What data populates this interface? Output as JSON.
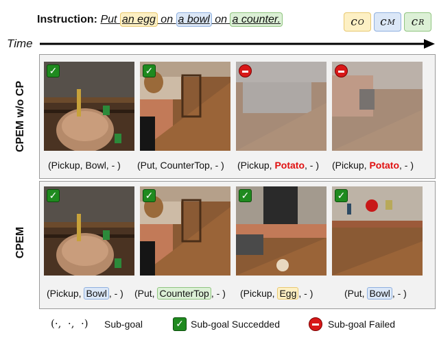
{
  "instruction": {
    "label": "Instruction:",
    "parts": [
      "Put ",
      "an egg",
      " on ",
      "a bowl",
      " on ",
      "a counter."
    ]
  },
  "tags": {
    "c_o": {
      "base": "c",
      "sub": "O"
    },
    "c_m": {
      "base": "c",
      "sub": "M"
    },
    "c_r": {
      "base": "c",
      "sub": "R"
    }
  },
  "time_label": "Time",
  "rows": [
    {
      "label": "CPEM w/o CP",
      "captions": [
        {
          "pre": "(Pickup, Bowl, - )",
          "mid": "",
          "post": ""
        },
        {
          "pre": "(Put, CounterTop, - )",
          "mid": "",
          "post": ""
        },
        {
          "pre": "(Pickup, ",
          "mid": "Potato",
          "post": ", - )"
        },
        {
          "pre": "(Pickup, ",
          "mid": "Potato",
          "post": ", - )"
        }
      ],
      "status": [
        "success",
        "success",
        "failed",
        "failed"
      ]
    },
    {
      "label": "CPEM",
      "captions": [
        {
          "pre": "(Pickup, ",
          "mid": "Bowl",
          "post": ", - )"
        },
        {
          "pre": "(Put, ",
          "mid": "CounterTop",
          "post": ", - )"
        },
        {
          "pre": "(Pickup, ",
          "mid": "Egg",
          "post": ", - )"
        },
        {
          "pre": "(Put, ",
          "mid": "Bowl",
          "post": ", - )"
        }
      ],
      "status": [
        "success",
        "success",
        "success",
        "success"
      ]
    }
  ],
  "legend": {
    "subgoal_symbol": "(·,  ·,  ·)",
    "subgoal": "Sub-goal",
    "succeeded": "Sub-goal Succedded",
    "failed": "Sub-goal Failed",
    "check_glyph": "✓"
  },
  "colors": {
    "object_highlight": "#fdf0c4",
    "mid_highlight": "#dbe7f7",
    "receptacle_highlight": "#dcf0d6",
    "success": "#1f8a1f",
    "failed": "#d81818",
    "error_text": "#e01010"
  }
}
